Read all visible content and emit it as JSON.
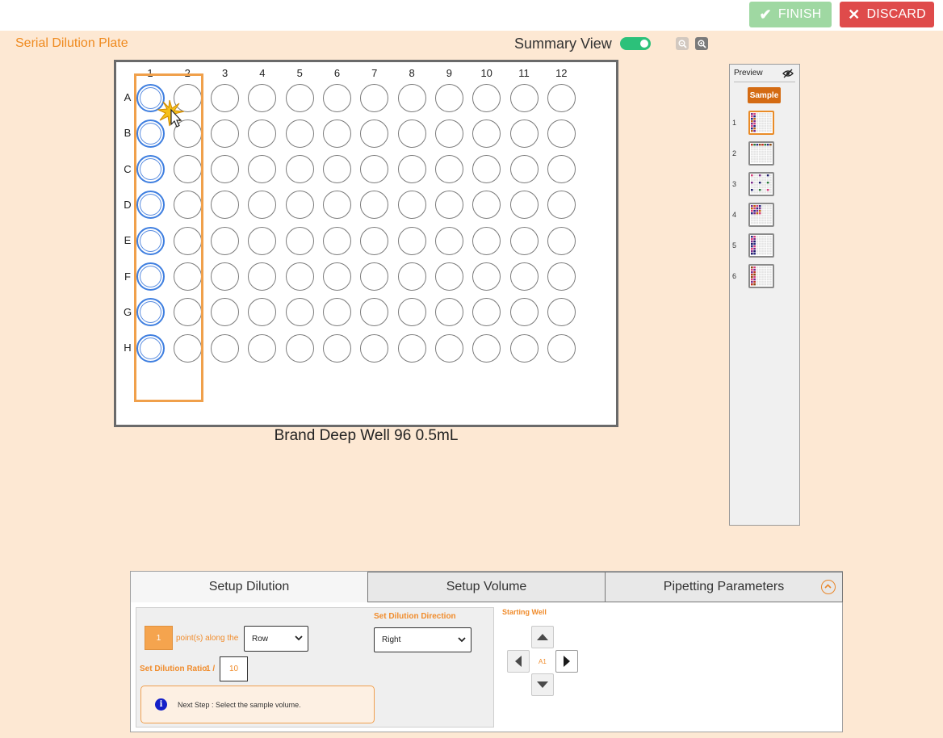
{
  "topbar": {
    "finish_label": "FINISH",
    "discard_label": "DISCARD",
    "finish_color": "#9fd8a2",
    "discard_color": "#df4b4b"
  },
  "page_title": "Serial Dilution Plate",
  "summary_view": {
    "label": "Summary View",
    "enabled": true
  },
  "zoom": {
    "out_icon": "zoom-out-icon",
    "in_icon": "zoom-in-icon"
  },
  "plate": {
    "name": "Brand Deep Well 96 0.5mL",
    "columns": [
      "1",
      "2",
      "3",
      "4",
      "5",
      "6",
      "7",
      "8",
      "9",
      "10",
      "11",
      "12"
    ],
    "rows": [
      "A",
      "B",
      "C",
      "D",
      "E",
      "F",
      "G",
      "H"
    ],
    "selected_column": "1",
    "highlight_color": "#f0a04b"
  },
  "preview": {
    "title": "Preview",
    "sample_label": "Sample",
    "items": [
      {
        "num": "1",
        "active": true
      },
      {
        "num": "2",
        "active": false
      },
      {
        "num": "3",
        "active": false
      },
      {
        "num": "4",
        "active": false
      },
      {
        "num": "5",
        "active": false
      },
      {
        "num": "6",
        "active": false
      }
    ]
  },
  "panel": {
    "tabs": [
      {
        "label": "Setup Dilution",
        "active": true
      },
      {
        "label": "Setup Volume",
        "active": false
      },
      {
        "label": "Pipetting Parameters",
        "active": false
      }
    ],
    "points_value": "1",
    "points_text": "point(s) along the",
    "along_select": "Row",
    "direction_title": "Set Dilution Direction",
    "direction_select": "Right",
    "ratio_label": "Set Dilution Ratio",
    "ratio_prefix": "1 /",
    "ratio_value": "10",
    "note": "Next Step : Select the sample volume.",
    "starting_well_label": "Starting Well",
    "starting_well_value": "A1"
  }
}
